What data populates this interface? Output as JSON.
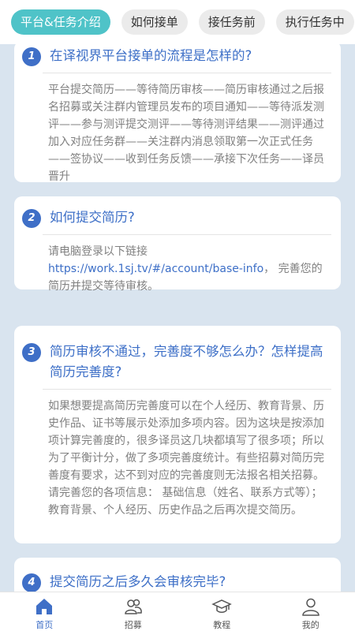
{
  "tabs": [
    {
      "label": "平台&任务介绍",
      "active": true
    },
    {
      "label": "如何接单",
      "active": false
    },
    {
      "label": "接任务前",
      "active": false
    },
    {
      "label": "执行任务中",
      "active": false
    }
  ],
  "faq": [
    {
      "number": "1",
      "question": "在译视界平台接单的流程是怎样的?",
      "answer": "平台提交简历——等待简历审核——简历审核通过之后报名招募或关注群内管理员发布的项目通知——等待派发测评——参与测评提交测评——等待测评结果——测评通过加入对应任务群——关注群内消息领取第一次正式任务——签协议——收到任务反馈——承接下次任务——译员晋升"
    },
    {
      "number": "2",
      "question": "如何提交简历?",
      "answer_prefix": "请电脑登录以下链接",
      "link": "https://work.1sj.tv/#/account/base-info",
      "answer_suffix": "， 完善您的简历并提交等待审核。"
    },
    {
      "number": "3",
      "question": "简历审核不通过，完善度不够怎么办？怎样提高简历完善度?",
      "answer": "如果想要提高简历完善度可以在个人经历、教育背景、历史作品、证书等展示处添加多项内容。因为这块是按添加项计算完善度的，很多译员这几块都填写了很多项；所以为了平衡计分，做了多项完善度统计。有些招募对简历完善度有要求，达不到对应的完善度则无法报名相关招募。请完善您的各项信息： 基础信息（姓名、联系方式等）；教育背景、个人经历、历史作品之后再次提交简历。"
    },
    {
      "number": "4",
      "question": "提交简历之后多久会审核完毕?"
    }
  ],
  "nav": [
    {
      "label": "首页",
      "icon": "home-icon",
      "active": true
    },
    {
      "label": "招募",
      "icon": "people-icon",
      "active": false
    },
    {
      "label": "教程",
      "icon": "graduation-cap-icon",
      "active": false
    },
    {
      "label": "我的",
      "icon": "user-icon",
      "active": false
    }
  ],
  "colors": {
    "accent": "#3f6fc7",
    "tab_active": "#4fc3c8",
    "background": "#d9e4ef"
  }
}
